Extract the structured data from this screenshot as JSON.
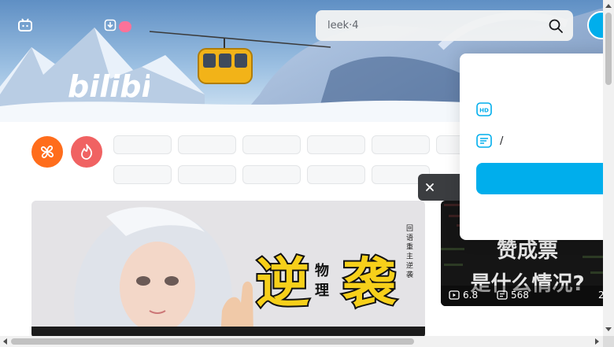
{
  "nav": {
    "items": [
      "",
      "",
      "",
      "",
      "",
      "",
      ""
    ],
    "download": "",
    "new_badge": ""
  },
  "search": {
    "placeholder": "leek·4"
  },
  "header": {
    "avatar_label": ""
  },
  "channels": {
    "hot_label": "",
    "popular_label": "",
    "pills_row1": [
      "",
      "",
      "",
      "",
      ""
    ],
    "pills_row2": [
      "",
      "",
      "",
      "",
      ""
    ]
  },
  "toast": {
    "text": ""
  },
  "popover": {
    "title": "",
    "feature_hd": "",
    "feature_comment": "/",
    "login_button": "",
    "link": ""
  },
  "side_card": {
    "title": "",
    "views": "6.8",
    "danmaku": "568",
    "extra": "2",
    "overlay_line1": "赞成票",
    "overlay_line2": "是什么情况?"
  },
  "big_card": {
    "title_char1": "逆",
    "title_char2": "袭",
    "subtitle_a": "物",
    "subtitle_b": "理",
    "vertical_text": "回 语 重 主 逆 袭"
  },
  "colors": {
    "accent": "#00aeec",
    "hot": "#ff6d1c",
    "popular": "#f06262",
    "badge": "#fb7299"
  }
}
